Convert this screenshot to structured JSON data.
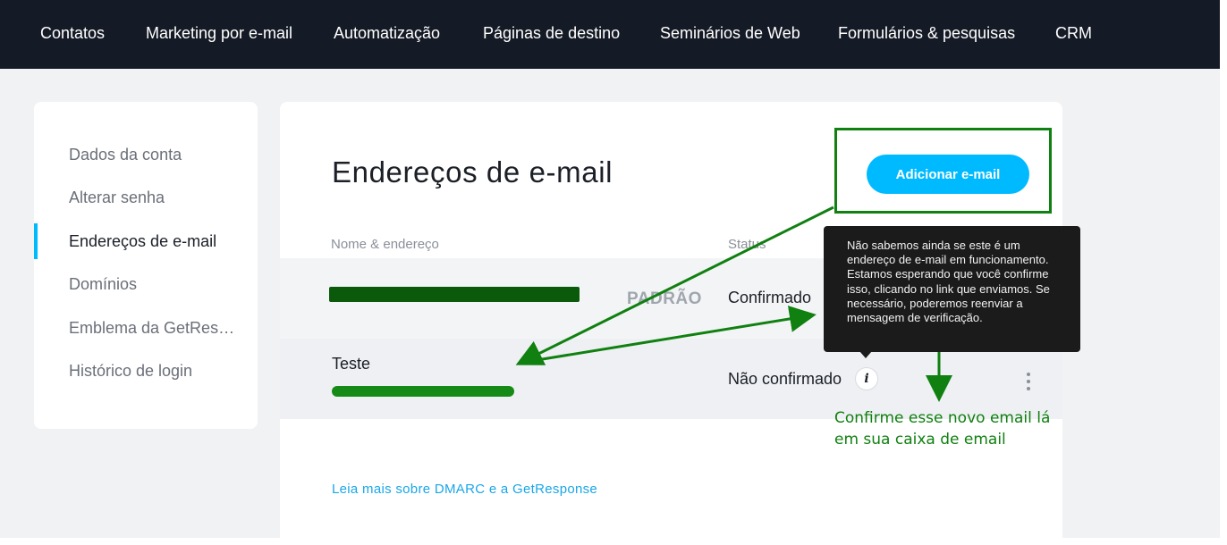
{
  "topnav": {
    "items": [
      "Contatos",
      "Marketing por e-mail",
      "Automatização",
      "Páginas de destino",
      "Seminários de Web",
      "Formulários & pesquisas",
      "CRM"
    ]
  },
  "sidebar": {
    "items": [
      "Dados da conta",
      "Alterar senha",
      "Endereços de e-mail",
      "Domínios",
      "Emblema da GetResponse",
      "Histórico de login"
    ],
    "active_index": 2
  },
  "main": {
    "title": "Endereços de e-mail",
    "add_button": "Adicionar e-mail",
    "columns": {
      "name": "Nome & endereço",
      "status": "Status"
    },
    "rows": [
      {
        "name": "",
        "email": "[redacted]",
        "badge": "PADRÃO",
        "status": "Confirmado"
      },
      {
        "name": "Teste",
        "email": "[redacted]",
        "badge": "",
        "status": "Não confirmado"
      }
    ],
    "dmarc_link": "Leia mais sobre DMARC e a GetResponse"
  },
  "tooltip": {
    "text": "Não sabemos ainda se este é um endereço de e-mail em funcionamento. Estamos esperando que você confirme isso, clicando no link que enviamos. Se necessário, poderemos reenviar a mensagem de verificação."
  },
  "annotation": {
    "line1": "Confirme esse novo email lá",
    "line2": "em sua caixa de email",
    "color": "#108010"
  },
  "colors": {
    "nav_bg": "#151b26",
    "accent": "#00baff",
    "annotation_green": "#108010"
  }
}
